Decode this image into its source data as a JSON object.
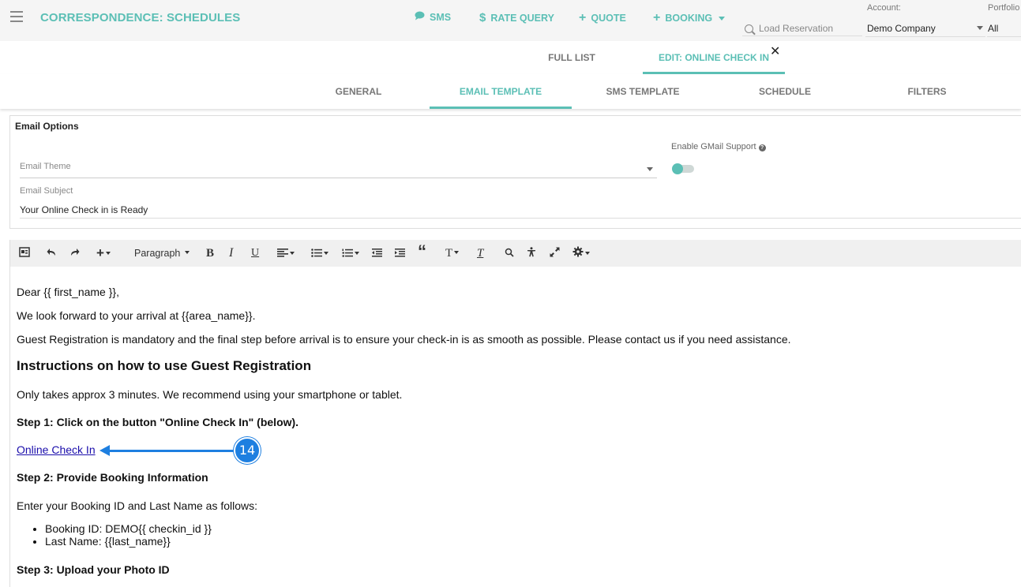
{
  "header": {
    "app_title": "CORRESPONDENCE: SCHEDULES",
    "nav": [
      {
        "label": "SMS",
        "icon": "comment-icon"
      },
      {
        "label": "RATE QUERY",
        "icon": "dollar-icon"
      },
      {
        "label": "QUOTE",
        "icon": "plus-icon"
      },
      {
        "label": "BOOKING",
        "icon": "plus-icon"
      }
    ],
    "search_placeholder": "Load Reservation",
    "account_label": "Account:",
    "account_value": "Demo Company",
    "portfolio_label": "Portfolio",
    "portfolio_value": "All"
  },
  "top_tabs": [
    "FULL LIST",
    "EDIT: ONLINE CHECK IN"
  ],
  "sub_tabs": [
    "GENERAL",
    "EMAIL TEMPLATE",
    "SMS TEMPLATE",
    "SCHEDULE",
    "FILTERS"
  ],
  "active_sub_tab": "EMAIL TEMPLATE",
  "email_options": {
    "title": "Email Options",
    "theme_label": "Email Theme",
    "subject_label": "Email Subject",
    "subject_value": "Your Online Check in is Ready",
    "gmail_label": "Enable GMail Support",
    "gmail_enabled": false
  },
  "toolbar": {
    "paragraph_label": "Paragraph",
    "bold": "B",
    "italic": "I",
    "underline": "U",
    "quote": "“",
    "text_style": "T",
    "clear_format": "T"
  },
  "content": {
    "greeting": "Dear {{ first_name }},",
    "line1": "We look forward to your arrival at {{area_name}}.",
    "line2": "Guest Registration is mandatory and the final step before arrival is to ensure your check-in is as smooth as possible. Please contact us if you need assistance.",
    "heading": "Instructions on how to use Guest Registration",
    "line3": "Only takes approx 3 minutes. We recommend using your smartphone or tablet.",
    "step1": "Step 1: Click on the button \"Online Check In\" (below).",
    "link": "Online Check In",
    "step2": "Step 2: Provide Booking Information",
    "line4": "Enter your Booking ID and Last Name as follows:",
    "bullets": [
      "Booking ID: DEMO{{ checkin_id }}",
      "Last Name: {{last_name}}"
    ],
    "step3": "Step 3: Upload your Photo ID"
  },
  "callout": {
    "number": "14",
    "color": "#1e7fe0"
  },
  "colors": {
    "accent": "#5bbfb5",
    "link": "#1a0dab"
  }
}
